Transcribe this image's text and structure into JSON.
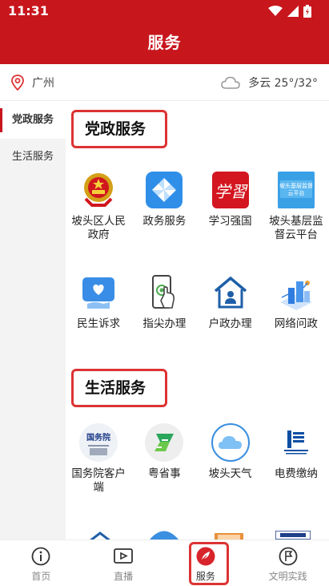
{
  "status_bar": {
    "time": "11:31"
  },
  "header": {
    "title": "服务"
  },
  "location": {
    "city": "广州"
  },
  "weather": {
    "text": "多云 25°/32°"
  },
  "sidebar": {
    "items": [
      {
        "label": "党政服务",
        "active": true
      },
      {
        "label": "生活服务",
        "active": false
      }
    ]
  },
  "sections": [
    {
      "title": "党政服务",
      "items": [
        {
          "label": "坡头区人民政府",
          "icon": "national-emblem-icon"
        },
        {
          "label": "政务服务",
          "icon": "pinwheel-icon"
        },
        {
          "label": "学习强国",
          "icon": "xuexi-qiangguo-icon"
        },
        {
          "label": "坡头基层监督云平台",
          "icon": "supervision-cloud-icon",
          "badge_text": "坡头基层监督\n云平台"
        },
        {
          "label": "民生诉求",
          "icon": "heart-hand-icon"
        },
        {
          "label": "指尖办理",
          "icon": "phone-touch-icon"
        },
        {
          "label": "户政办理",
          "icon": "household-house-icon"
        },
        {
          "label": "网络问政",
          "icon": "network-building-icon"
        }
      ]
    },
    {
      "title": "生活服务",
      "items": [
        {
          "label": "国务院客户端",
          "icon": "state-council-icon",
          "badge_text": "国务院"
        },
        {
          "label": "粤省事",
          "icon": "yueshengshi-icon"
        },
        {
          "label": "坡头天气",
          "icon": "cloud-weather-icon"
        },
        {
          "label": "电费缴纳",
          "icon": "power-grid-icon"
        }
      ]
    }
  ],
  "tabbar": {
    "items": [
      {
        "label": "首页",
        "icon": "info-icon",
        "active": false
      },
      {
        "label": "直播",
        "icon": "video-play-icon",
        "active": false
      },
      {
        "label": "服务",
        "icon": "feather-icon",
        "active": true
      },
      {
        "label": "文明实践",
        "icon": "flag-icon",
        "active": false
      }
    ]
  },
  "colors": {
    "brand_red": "#c8161d",
    "highlight": "#d33333"
  }
}
